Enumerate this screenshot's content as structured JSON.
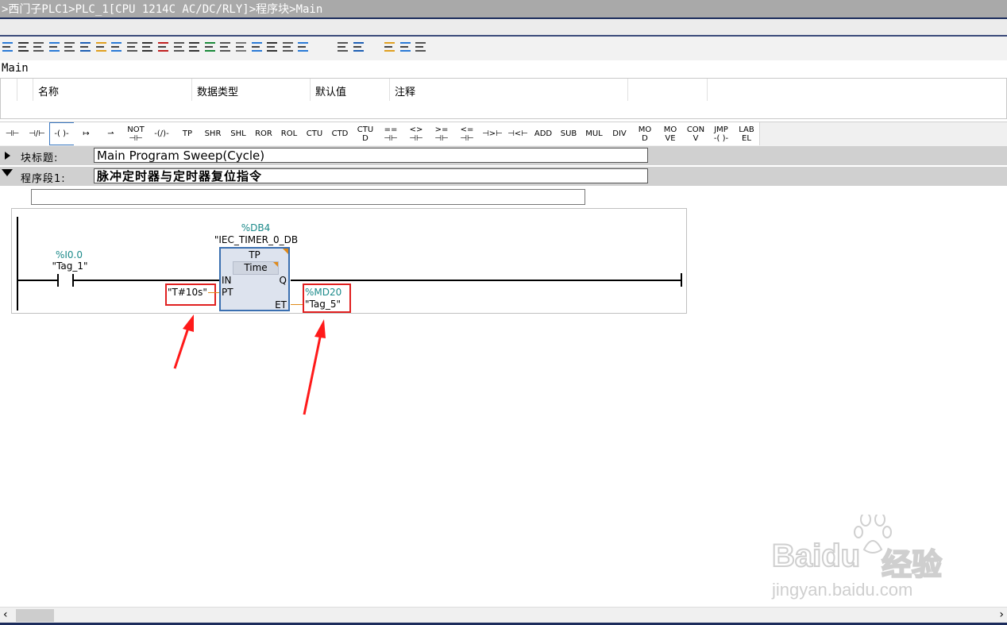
{
  "breadcrumb": ">西门子PLC1>PLC_1[CPU 1214C AC/DC/RLY]>程序块>Main",
  "toolbar_icons": [
    "insert-network-icon",
    "delete-network-icon",
    "insert-row-icon",
    "add-row-icon",
    "insert-rung-icon",
    "absolute-relative-icon",
    "favorites-icon",
    "show-hide-comments-icon",
    "display-operand-icon",
    "network-comments-icon",
    "symbol-info-icon",
    "toggle-symbolic-icon",
    "monitor-icon",
    "go-to-error-icon",
    "go-to-previous-icon",
    "go-to-next-icon",
    "compare-icon",
    "download-icon",
    "check-icon",
    "update-calls-icon",
    "show-list-icon",
    "cross-ref-icon",
    "monitor-on-off-icon",
    "simulation-icon",
    "load-icon"
  ],
  "block_name": "Main",
  "interface": {
    "columns": [
      "名称",
      "数据类型",
      "默认值",
      "注释"
    ]
  },
  "instructions": [
    {
      "l1": "⊣⊢",
      "l2": ""
    },
    {
      "l1": "⊣/⊢",
      "l2": ""
    },
    {
      "l1": "-( )-",
      "l2": ""
    },
    {
      "l1": "↦",
      "l2": ""
    },
    {
      "l1": "⇀",
      "l2": ""
    },
    {
      "l1": "NOT",
      "l2": "⊣⊢"
    },
    {
      "l1": "-(/)-",
      "l2": ""
    },
    {
      "l1": "TP",
      "l2": ""
    },
    {
      "l1": "SHR",
      "l2": ""
    },
    {
      "l1": "SHL",
      "l2": ""
    },
    {
      "l1": "ROR",
      "l2": ""
    },
    {
      "l1": "ROL",
      "l2": ""
    },
    {
      "l1": "CTU",
      "l2": ""
    },
    {
      "l1": "CTD",
      "l2": ""
    },
    {
      "l1": "CTU",
      "l2": "D"
    },
    {
      "l1": "==",
      "l2": "⊣⊢"
    },
    {
      "l1": "<>",
      "l2": "⊣⊢"
    },
    {
      "l1": ">=",
      "l2": "⊣⊢"
    },
    {
      "l1": "<=",
      "l2": "⊣⊢"
    },
    {
      "l1": "⊣>⊢",
      "l2": ""
    },
    {
      "l1": "⊣<⊢",
      "l2": ""
    },
    {
      "l1": "ADD",
      "l2": ""
    },
    {
      "l1": "SUB",
      "l2": ""
    },
    {
      "l1": "MUL",
      "l2": ""
    },
    {
      "l1": "DIV",
      "l2": ""
    },
    {
      "l1": "MO",
      "l2": "D"
    },
    {
      "l1": "MO",
      "l2": "VE"
    },
    {
      "l1": "CON",
      "l2": "V"
    },
    {
      "l1": "JMP",
      "l2": "-( )-"
    },
    {
      "l1": "LAB",
      "l2": "EL"
    }
  ],
  "block_title": {
    "label": "块标题:",
    "value": "Main Program Sweep(Cycle)"
  },
  "network1": {
    "label": "程序段1:",
    "title": "脉冲定时器与定时器复位指令",
    "comment": ""
  },
  "ladder": {
    "contact_address": "%I0.0",
    "contact_tag": "\"Tag_1\"",
    "db_address": "%DB4",
    "db_name": "\"IEC_TIMER_0_DB",
    "timer_type": "TP",
    "timer_datatype": "Time",
    "pin_in": "IN",
    "pin_pt": "PT",
    "pin_q": "Q",
    "pin_et": "ET",
    "pt_value": "\"T#10s\"",
    "et_address": "%MD20",
    "et_tag": "\"Tag_5\""
  },
  "watermark": {
    "brand": "Baidu",
    "cn": "经验",
    "url": "jingyan.baidu.com"
  },
  "colors": {
    "operand": "#1c8a8a",
    "highlight": "#e02020",
    "box_border": "#3a6fb0",
    "box_fill": "#dde3ee"
  }
}
